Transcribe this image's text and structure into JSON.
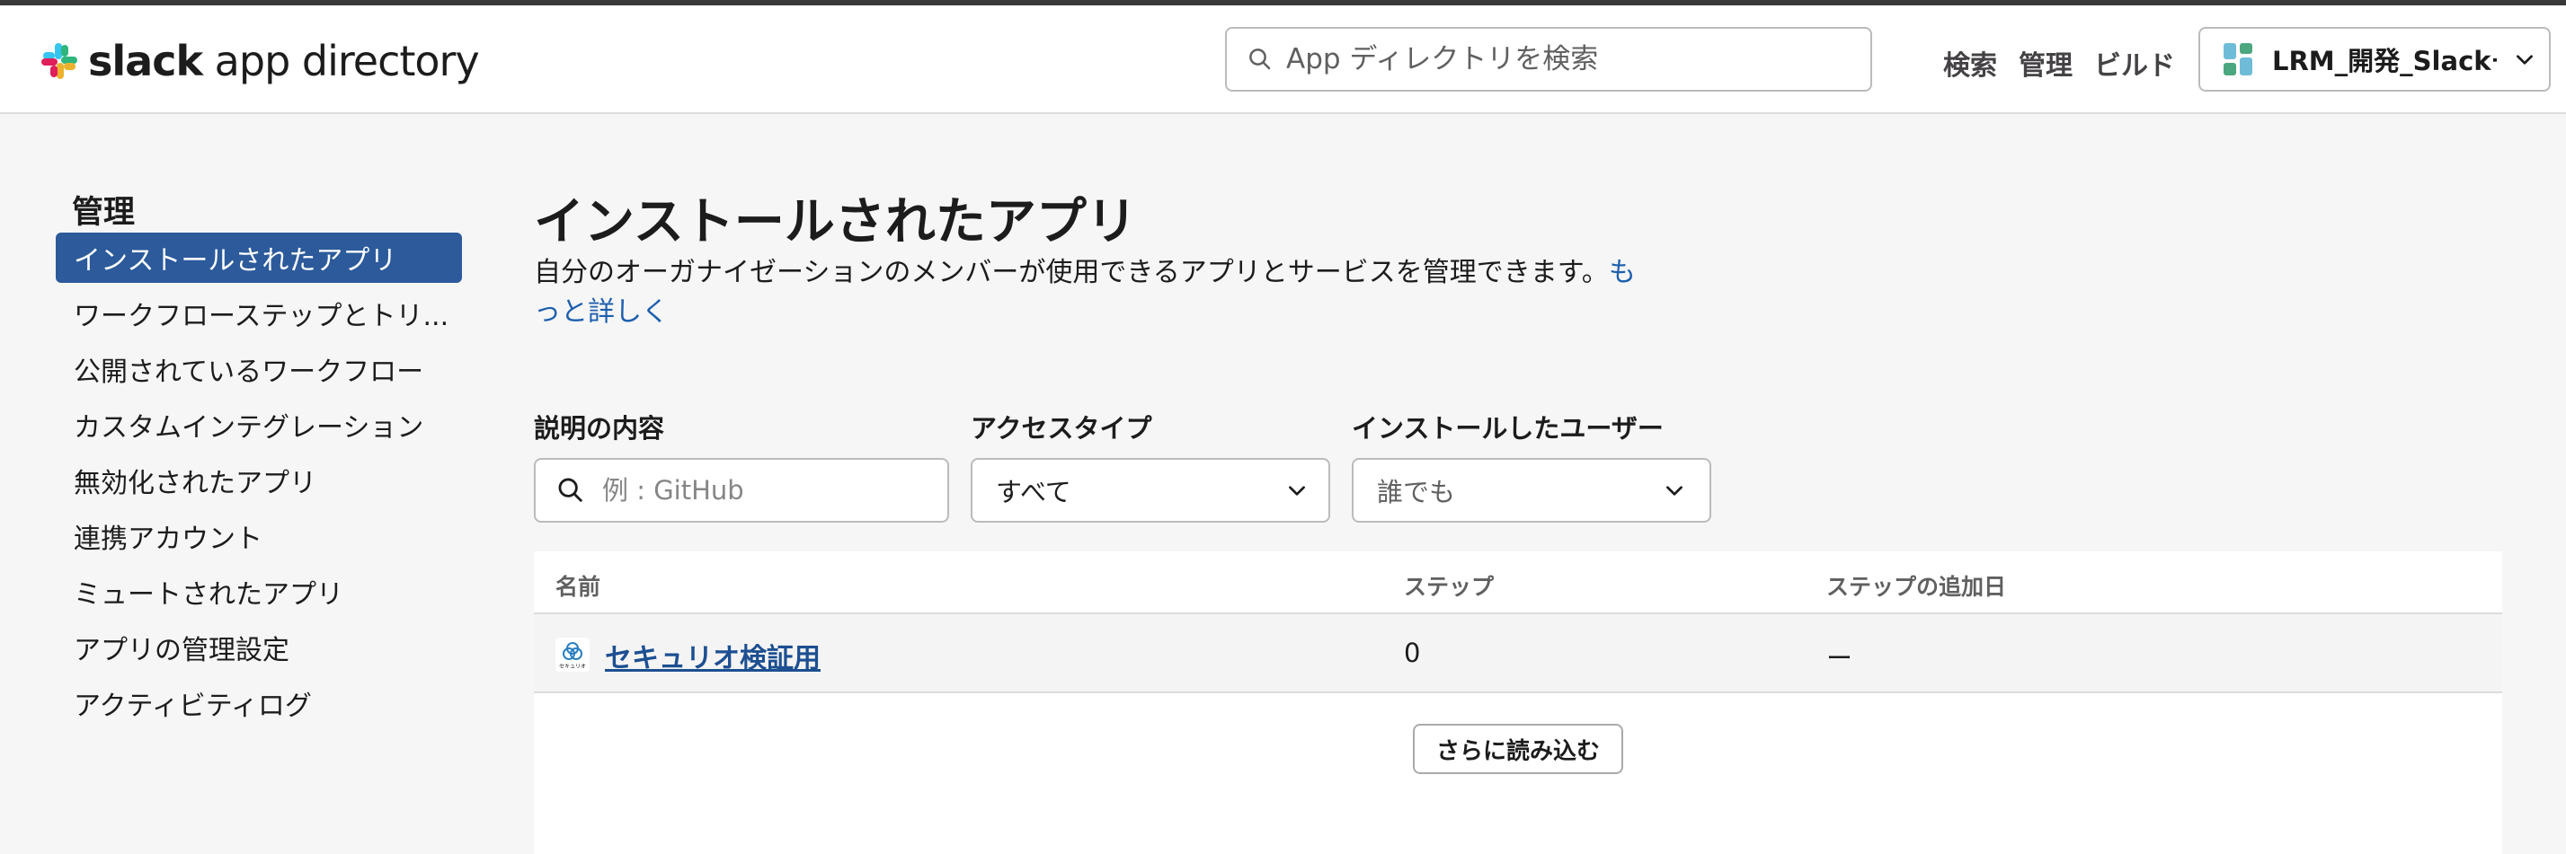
{
  "header": {
    "logo_text_bold": "slack",
    "logo_text_rest": " app directory",
    "search_placeholder": "App ディレクトリを検索",
    "nav": [
      "検索",
      "管理",
      "ビルド"
    ],
    "workspace_name": "LRM_開発_Slackー"
  },
  "sidebar": {
    "title": "管理",
    "items": [
      {
        "label": "インストールされたアプリ",
        "active": true
      },
      {
        "label": "ワークフローステップとトリ..."
      },
      {
        "label": "公開されているワークフロー"
      },
      {
        "label": "カスタムインテグレーション"
      },
      {
        "label": "無効化されたアプリ"
      },
      {
        "label": "連携アカウント"
      },
      {
        "label": "ミュートされたアプリ"
      },
      {
        "label": "アプリの管理設定"
      },
      {
        "label": "アクティビティログ"
      }
    ]
  },
  "main": {
    "title": "インストールされたアプリ",
    "description": "自分のオーガナイゼーションのメンバーが使用できるアプリとサービスを管理できます。",
    "learn_more": "もっと詳しく",
    "filters": {
      "description_label": "説明の内容",
      "description_placeholder": "例 : GitHub",
      "access_label": "アクセスタイプ",
      "access_value": "すべて",
      "installer_label": "インストールしたユーザー",
      "installer_value": "誰でも"
    },
    "table": {
      "columns": [
        "名前",
        "ステップ",
        "ステップの追加日"
      ],
      "rows": [
        {
          "name": "セキュリオ検証用",
          "icon_caption": "セキュリオ",
          "steps": "0",
          "date": "ー"
        }
      ],
      "load_more": "さらに読み込む"
    }
  },
  "icons": [
    "slack-logo-icon",
    "search-icon",
    "workspace-icon",
    "chevron-down-icon",
    "app-icon"
  ]
}
